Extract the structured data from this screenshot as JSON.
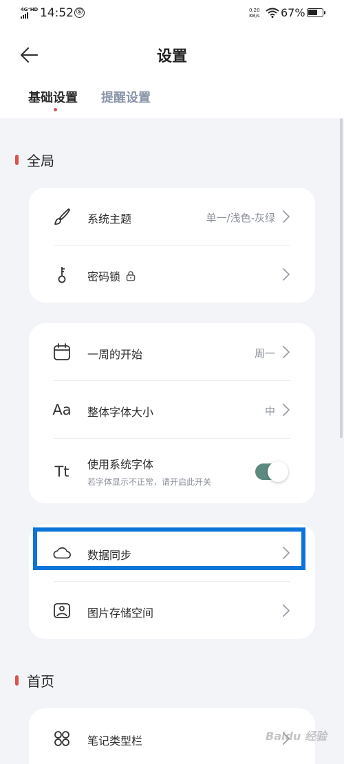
{
  "status_bar": {
    "network": "4G⁺HD",
    "time": "14:52",
    "app_icon": "Ⓢ",
    "speed_value": "0.20",
    "speed_unit": "KB/s",
    "battery_pct": "67%",
    "battery_level": 0.67
  },
  "header": {
    "title": "设置",
    "tabs": [
      {
        "label": "基础设置",
        "active": true
      },
      {
        "label": "提醒设置",
        "active": false
      }
    ]
  },
  "sections": {
    "global": {
      "title": "全局"
    },
    "home": {
      "title": "首页"
    }
  },
  "card1": {
    "theme": {
      "label": "系统主题",
      "value": "单一/浅色-灰绿",
      "icon": "brush-icon"
    },
    "lock": {
      "label": "密码锁",
      "icon": "key-icon",
      "badge_icon": "lock-icon"
    }
  },
  "card2": {
    "week_start": {
      "label": "一周的开始",
      "value": "周一",
      "icon": "calendar-icon"
    },
    "font_size": {
      "label": "整体字体大小",
      "value": "中",
      "icon_text": "Aa"
    },
    "system_font": {
      "label": "使用系统字体",
      "sub": "若字体显示不正常，请开启此开关",
      "icon_text": "Tt",
      "enabled": true
    }
  },
  "card3": {
    "sync": {
      "label": "数据同步",
      "icon": "cloud-icon"
    },
    "image_storage": {
      "label": "图片存储空间",
      "icon": "image-icon"
    }
  },
  "card4": {
    "note_type": {
      "label": "笔记类型栏",
      "icon": "grid-icon"
    }
  },
  "watermark": "Baidu 经验",
  "colors": {
    "accent_red": "#d9534f",
    "toggle_green": "#5d8a80",
    "highlight_blue": "#0a74d9",
    "background": "#f3f4f8"
  }
}
